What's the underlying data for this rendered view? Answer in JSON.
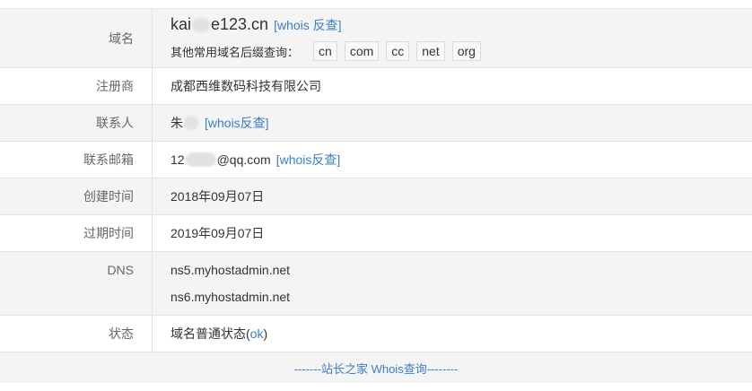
{
  "rows": {
    "domain": {
      "label": "域名",
      "domain_prefix": "kai",
      "domain_suffix": "e123.cn",
      "whois_link": "[whois 反查]",
      "suffix_prompt": "其他常用域名后缀查询：",
      "suffixes": [
        "cn",
        "com",
        "cc",
        "net",
        "org"
      ]
    },
    "registrar": {
      "label": "注册商",
      "value": "成都西维数码科技有限公司"
    },
    "contact": {
      "label": "联系人",
      "value_prefix": "朱",
      "whois_link": "[whois反查]"
    },
    "email": {
      "label": "联系邮箱",
      "value_prefix": "12",
      "value_suffix": "@qq.com",
      "whois_link": "[whois反查]"
    },
    "created": {
      "label": "创建时间",
      "value": "2018年09月07日"
    },
    "expires": {
      "label": "过期时间",
      "value": "2019年09月07日"
    },
    "dns": {
      "label": "DNS",
      "servers": [
        "ns5.myhostadmin.net",
        "ns6.myhostadmin.net"
      ]
    },
    "status": {
      "label": "状态",
      "value_prefix": "域名普通状态(",
      "value_link": "ok",
      "value_suffix": ")"
    }
  },
  "footer": {
    "link": "-------站长之家 Whois查询--------"
  },
  "colors": {
    "link": "#3a7ec4",
    "row_gray": "#f4f4f4",
    "border": "#e3e3e3"
  }
}
